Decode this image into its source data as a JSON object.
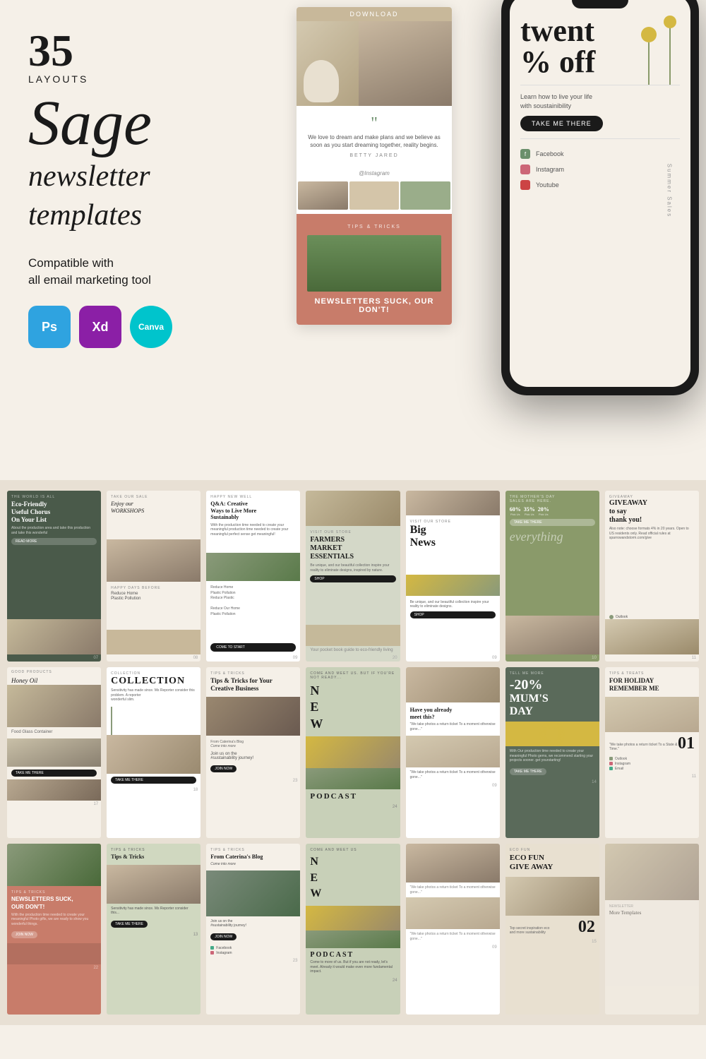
{
  "header": {
    "layouts_number": "35",
    "layouts_label": "LAYOUTS",
    "brand_name": "Sage",
    "subtitle1": "newsletter",
    "subtitle2": "templates",
    "compat_text": "Compatible with\nall email marketing tool",
    "badges": [
      {
        "id": "ps",
        "label": "Ps",
        "type": "photoshop"
      },
      {
        "id": "xd",
        "label": "Xd",
        "type": "adobe-xd"
      },
      {
        "id": "canva",
        "label": "Canva",
        "type": "canva"
      }
    ]
  },
  "newsletter_preview": {
    "download_btn": "DOWNLOAD",
    "quote": "We love to dream and make plans and we believe as soon as you start dreaming together, reality begins.",
    "author": "BETTY JARED",
    "instagram_label": "@Instagram",
    "tips_label": "TIPS & TRICKS",
    "cta_text": "NEWSLETTERS SUCK, OUR DON'T!"
  },
  "phone_mockup": {
    "big_text": "twent",
    "percent_text": "% off",
    "subtitle": "Learn how to live your life\nwith soustainibility",
    "cta": "TAKE ME THERE",
    "social_items": [
      "Facebook",
      "Instagram",
      "Youtube"
    ],
    "side_label": "Summer Sales"
  },
  "templates": {
    "grid_label": "Template grid showing 35 layouts",
    "cards": [
      {
        "id": 1,
        "title": "Eco-Friendly Useful Chorus On Your List",
        "style": "dark-green"
      },
      {
        "id": 2,
        "title": "Enjoy our WORKSHOPS",
        "style": "cream"
      },
      {
        "id": 3,
        "title": "Q&A: Creative Ways to Live More Sustainably",
        "style": "white"
      },
      {
        "id": 4,
        "title": "FARMERS MARKET ESSENTIALS",
        "style": "sage"
      },
      {
        "id": 5,
        "title": "Big News",
        "style": "white"
      },
      {
        "id": 6,
        "title": "THE MOTHER'S DAY SALES ARE HERE.",
        "style": "olive"
      },
      {
        "id": 7,
        "title": "GIVEAWAY to say thank you!",
        "style": "white"
      },
      {
        "id": 8,
        "title": "Honey Oil",
        "style": "white"
      },
      {
        "id": 9,
        "title": "COLLECTION",
        "style": "collection"
      },
      {
        "id": 10,
        "title": "Tips & Tricks for Your Creative Business",
        "style": "cream"
      },
      {
        "id": 11,
        "title": "N E W",
        "style": "sage"
      },
      {
        "id": 12,
        "title": "Have you already meet this?",
        "style": "white"
      },
      {
        "id": 13,
        "title": "-20% MUM'S DAY",
        "style": "dark"
      },
      {
        "id": 14,
        "title": "FOR HOLIDAY REMEMBER ME",
        "style": "white"
      },
      {
        "id": 15,
        "title": "NEWSLETTERS SUCK, OUR DON'T!",
        "style": "terracotta"
      },
      {
        "id": 16,
        "title": "Tips & Tricks",
        "style": "sage"
      },
      {
        "id": 17,
        "title": "From Caterina's Blog",
        "style": "cream"
      },
      {
        "id": 18,
        "title": "PODCAST",
        "style": "olive"
      },
      {
        "id": 19,
        "title": "We take photos a return ticket",
        "style": "white"
      },
      {
        "id": 20,
        "title": "ECO FUN GIVE AWAY",
        "style": "tan"
      }
    ]
  }
}
